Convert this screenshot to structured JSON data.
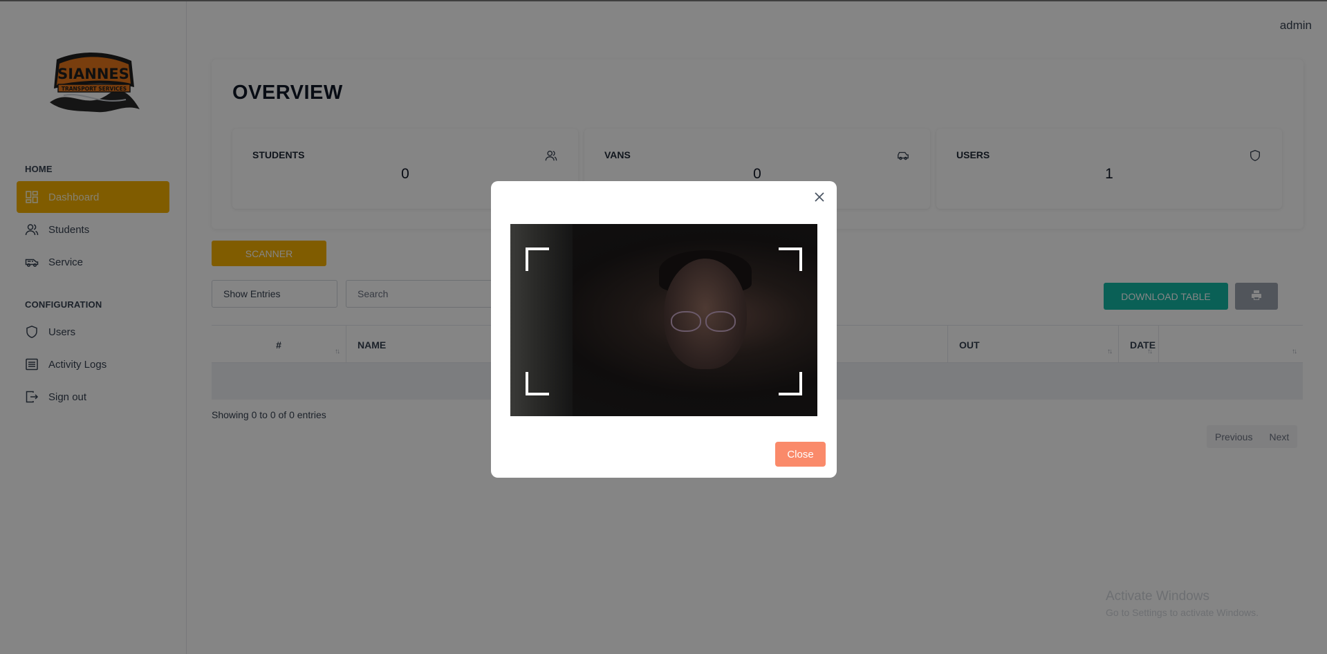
{
  "sidebar": {
    "logo_text": "SIANNES",
    "logo_subtext": "TRANSPORT SERVICES",
    "sections": [
      {
        "title": "HOME",
        "items": [
          {
            "label": "Dashboard",
            "icon": "dashboard-icon",
            "active": true
          },
          {
            "label": "Students",
            "icon": "users-icon"
          },
          {
            "label": "Service",
            "icon": "van-icon"
          }
        ]
      },
      {
        "title": "CONFIGURATION",
        "items": [
          {
            "label": "Users",
            "icon": "shield-icon"
          },
          {
            "label": "Activity Logs",
            "icon": "list-icon"
          },
          {
            "label": "Sign out",
            "icon": "sign-out-icon"
          }
        ]
      }
    ],
    "accent_color": "#f5b000"
  },
  "header": {
    "user": "admin"
  },
  "overview": {
    "title": "OVERVIEW",
    "stats": [
      {
        "label": "STUDENTS",
        "value": "0",
        "icon": "users-icon"
      },
      {
        "label": "VANS",
        "value": "0",
        "icon": "car-icon"
      },
      {
        "label": "USERS",
        "value": "1",
        "icon": "shield-icon"
      }
    ]
  },
  "toolbar": {
    "scanner_label": "SCANNER",
    "show_entries": "Show Entries",
    "search_placeholder": "Search",
    "download_label": "DOWNLOAD TABLE",
    "print_icon": "print-icon"
  },
  "table": {
    "columns": [
      "#",
      "NAME",
      "OUT",
      "DATE"
    ],
    "rows": [],
    "showing": "Showing 0 to 0 of 0 entries",
    "pagination": {
      "previous": "Previous",
      "next": "Next"
    }
  },
  "modal": {
    "close_label": "Close",
    "close_icon": "close-icon",
    "close_color": "#fa8a6a"
  },
  "windows_watermark": {
    "line1": "Activate Windows",
    "line2": "Go to Settings to activate Windows."
  }
}
